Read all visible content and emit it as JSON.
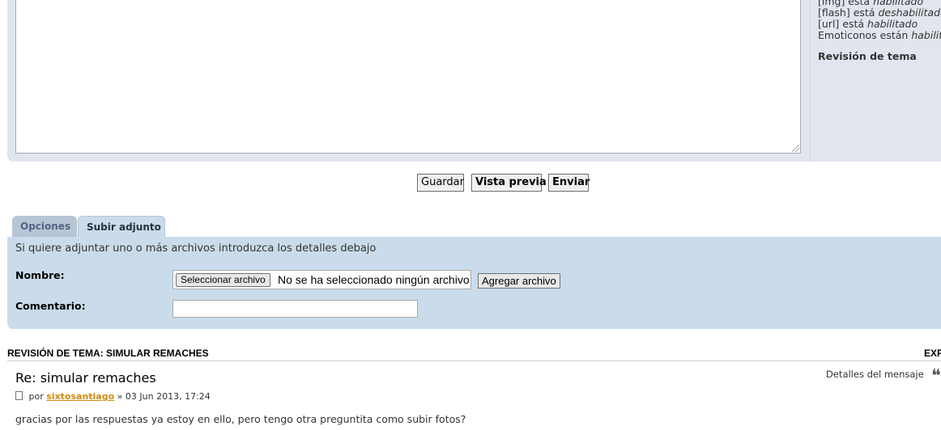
{
  "editor": {
    "bbcode_status": [
      {
        "tag": "[img] está",
        "state": "habilitado"
      },
      {
        "tag": "[flash] está",
        "state": "deshabilitado"
      },
      {
        "tag": "[url] está",
        "state": "habilitado"
      },
      {
        "tag": "Emoticonos están",
        "state": "habilitados"
      }
    ],
    "topic_review_link": "Revisión de tema"
  },
  "buttons": {
    "save": "Guardar",
    "preview": "Vista previa",
    "submit": "Enviar"
  },
  "tabs": {
    "options": "Opciones",
    "upload": "Subir adjunto"
  },
  "upload": {
    "intro": "Si quiere adjuntar uno o más archivos introduzca los detalles debajo",
    "name_label": "Nombre:",
    "file_button": "Seleccionar archivo",
    "file_status": "No se ha seleccionado ningún archivo",
    "add_button": "Agregar archivo",
    "comment_label": "Comentario:",
    "comment_value": ""
  },
  "review": {
    "header": "Revisión de tema: SIMULAR REMACHES",
    "expand": "EXP",
    "post": {
      "title": "Re: simular remaches",
      "details_link": "Detalles del mensaje",
      "by": "por",
      "author": "sixtosantiago",
      "separator": "»",
      "date": "03 Jun 2013, 17:24",
      "body": "gracias por las respuestas ya estoy en ello, pero tengo otra preguntita como subir fotos?"
    }
  }
}
